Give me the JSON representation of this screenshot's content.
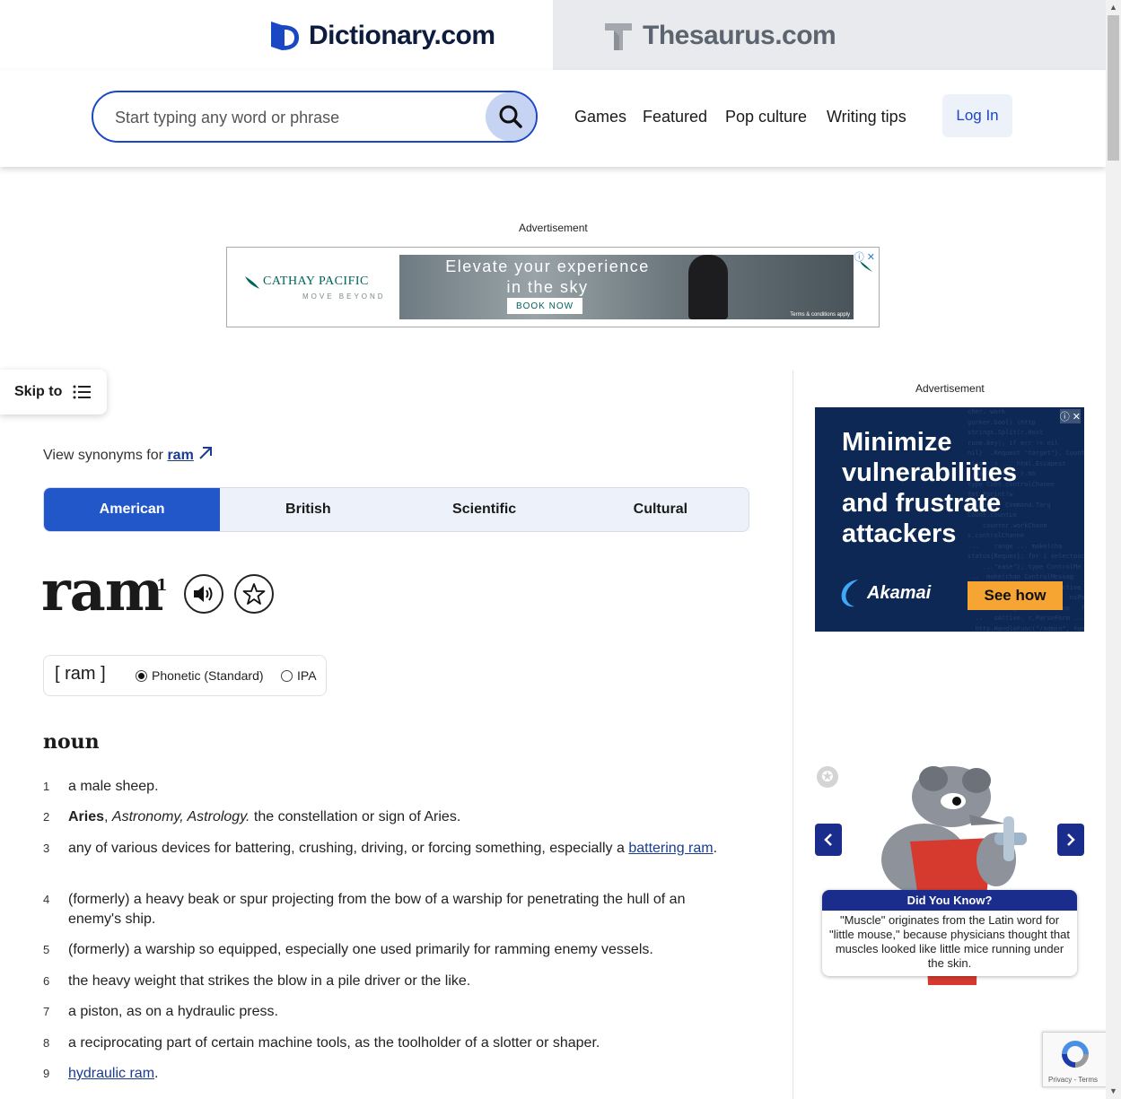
{
  "header": {
    "dictionary_logo": "Dictionary.com",
    "thesaurus_logo": "Thesaurus.com",
    "search_placeholder": "Start typing any word or phrase",
    "nav": [
      "Games",
      "Featured",
      "Pop culture",
      "Writing tips"
    ],
    "login": "Log In"
  },
  "ads": {
    "label": "Advertisement",
    "top": {
      "brand": "CATHAY PACIFIC",
      "tagline": "MOVE BEYOND",
      "headline": "Elevate your experience in the sky",
      "cta": "BOOK NOW",
      "terms": "Terms & conditions apply"
    },
    "side": {
      "headline": "Minimize vulnerabilities and frustrate attackers",
      "brand": "Akamai",
      "cta": "See how"
    }
  },
  "skip_to": "Skip to",
  "entry": {
    "synonyms_prefix": "View synonyms for",
    "synonyms_word": "ram",
    "dialect_tabs": [
      "American",
      "British",
      "Scientific",
      "Cultural"
    ],
    "active_tab": "American",
    "headword": "ram",
    "homograph": "1",
    "pronunciation": "[ ram ]",
    "pron_options": [
      "Phonetic (Standard)",
      "IPA"
    ],
    "part_of_speech": "noun",
    "definitions": [
      {
        "num": "1",
        "text": "a male sheep."
      },
      {
        "num": "2",
        "bold": "Aries",
        "italic": "Astronomy, Astrology.",
        "text": "the constellation or sign of Aries."
      },
      {
        "num": "3",
        "text": "any of various devices for battering, crushing, driving, or forcing something, especially a",
        "link": "battering ram",
        "after": "."
      },
      {
        "num": "4",
        "text": "(formerly) a heavy beak or spur projecting from the bow of a warship for penetrating the hull of an enemy's ship."
      },
      {
        "num": "5",
        "text": "(formerly) a warship so equipped, especially one used primarily for ramming enemy vessels."
      },
      {
        "num": "6",
        "text": "the heavy weight that strikes the blow in a pile driver or the like."
      },
      {
        "num": "7",
        "text": "a piston, as on a hydraulic press."
      },
      {
        "num": "8",
        "text": "a reciprocating part of certain machine tools, as the toolholder of a slotter or shaper."
      },
      {
        "num": "9",
        "text": "",
        "link": "hydraulic ram",
        "after": "."
      }
    ]
  },
  "did_you_know": {
    "title": "Did You Know?",
    "body": "\"Muscle\" originates from the Latin word for \"little mouse,\" because physicians thought that muscles looked like little mice running under the skin."
  },
  "recaptcha": {
    "privacy": "Privacy",
    "terms": "Terms"
  },
  "colors": {
    "brand_blue": "#2257c9",
    "navy": "#0d1c3d",
    "link": "#1a3c8f",
    "akamai_orange": "#f6a532"
  }
}
